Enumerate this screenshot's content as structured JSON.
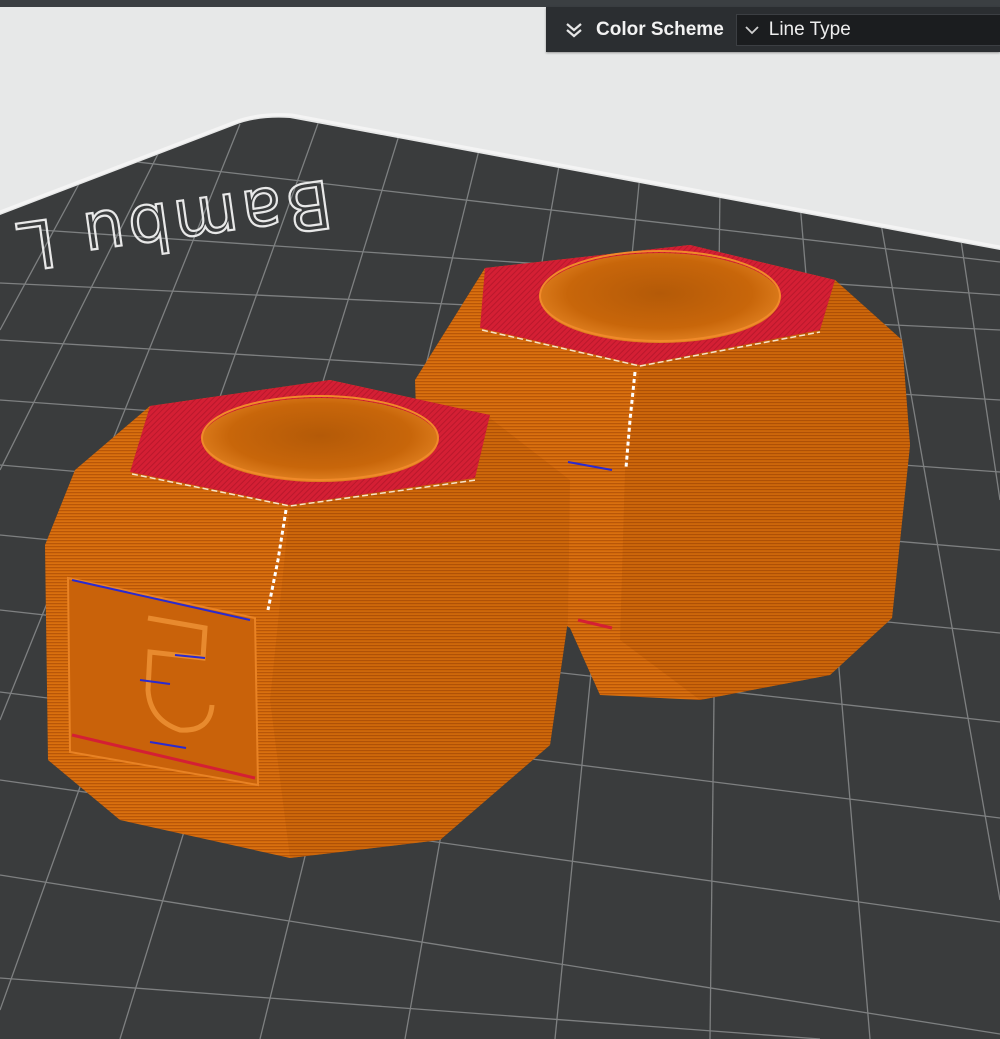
{
  "panel": {
    "title": "Color Scheme",
    "selected_value": "Line Type",
    "collapse_icon": "double-chevron-down-icon",
    "dropdown_icon": "chevron-down-icon"
  },
  "plate": {
    "brand_text": "Bambu L"
  },
  "colors": {
    "background": "#e7e8e8",
    "plate": "#3a3c3d",
    "grid": "#8b8d8e",
    "outer_wall": "#d2690a",
    "top_surface": "#d41f34",
    "seam": "#ffffff",
    "bridge": "#2a2ad0",
    "panel_bg": "#2b2e31",
    "panel_text": "#f2f2f2"
  }
}
